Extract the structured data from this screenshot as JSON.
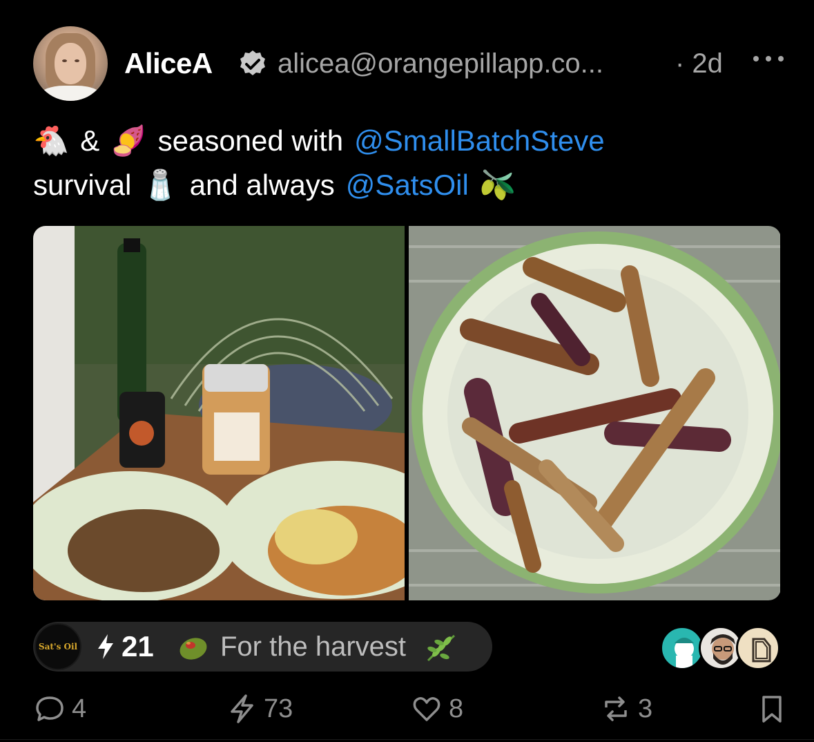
{
  "author": {
    "name": "AliceA",
    "handle": "alicea@orangepillapp.co...",
    "time": "· 2d",
    "verified": true,
    "avatar_icon": "profile-photo"
  },
  "content": {
    "emoji_chicken": "🐔",
    "amp": "&",
    "emoji_sweet_potato": "🍠",
    "text1": "seasoned with",
    "mention1": "@SmallBatchSteve",
    "text2": "survival",
    "emoji_salt": "🧂",
    "text3": "and always",
    "mention2": "@SatsOil",
    "emoji_olive": "🫒"
  },
  "media": {
    "count": 2,
    "photos": [
      "bottle-jar-and-two-plates-of-chicken-photo",
      "plate-of-roasted-sweet-potato-fries-photo"
    ]
  },
  "zap": {
    "sender_label": "Sat's Oil",
    "amount": "21",
    "message": "For the harvest",
    "olive_icon": "olive-icon",
    "leaf_icon": "herb-icon",
    "zappers": [
      "zapper-avatar-1",
      "zapper-avatar-2",
      "zapper-avatar-3"
    ]
  },
  "actions": {
    "replies": "4",
    "zaps": "73",
    "likes": "8",
    "reposts": "3"
  },
  "colors": {
    "background": "#000000",
    "mention": "#2f8eed",
    "muted": "#a6a6a6",
    "pill": "#262626"
  }
}
